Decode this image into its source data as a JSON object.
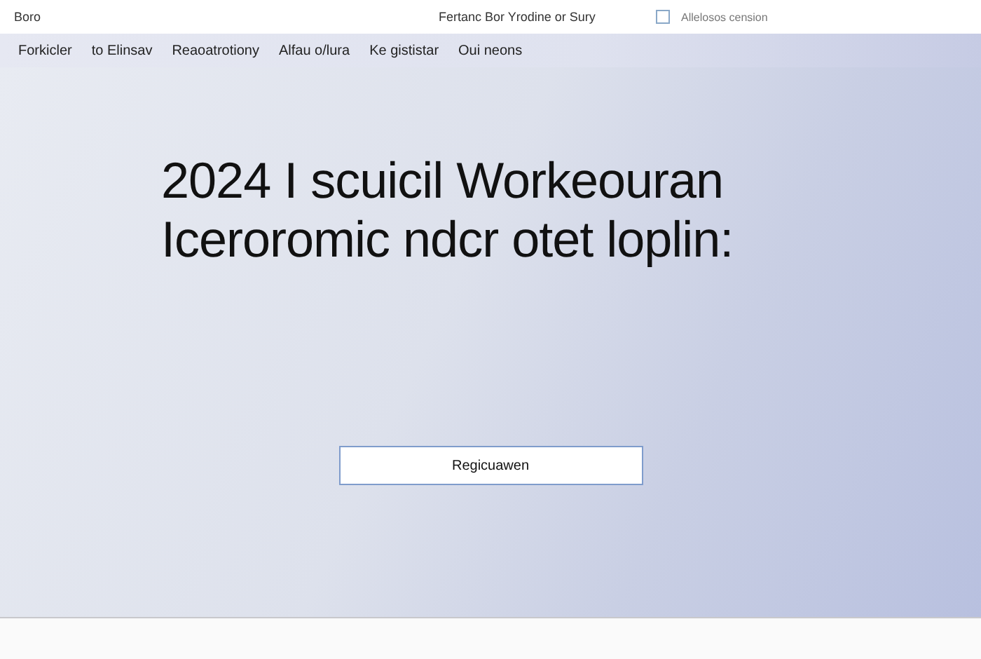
{
  "top_bar": {
    "brand": "Boro",
    "title": "Fertanc Bor Yrodine or Sury",
    "option": {
      "label": "Allelosos cension",
      "checked": false
    }
  },
  "nav": {
    "items": [
      {
        "label": "Forkicler"
      },
      {
        "label": "to Elinsav"
      },
      {
        "label": "Reaoatrotiony"
      },
      {
        "label": "Alfau o/lura"
      },
      {
        "label": "Ke gististar"
      },
      {
        "label": "Oui neons"
      }
    ]
  },
  "hero": {
    "heading_lines": [
      "2024 I scuicil Workeouran",
      "Iceroromic ndcr otet loplin:"
    ],
    "button": "Regicuawen"
  }
}
